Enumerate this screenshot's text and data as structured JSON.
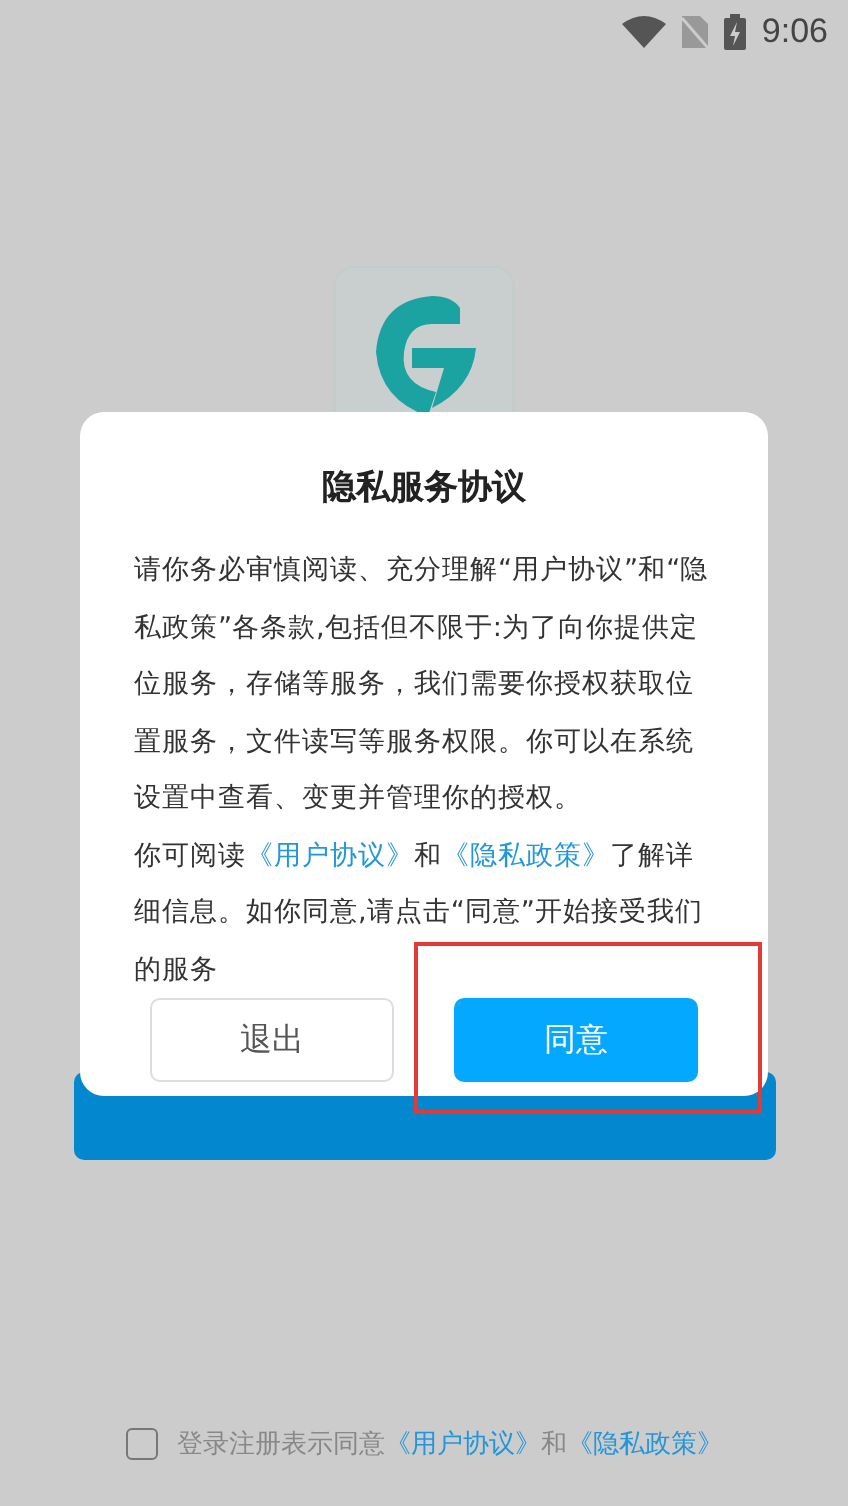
{
  "status_bar": {
    "time": "9:06"
  },
  "agreement": {
    "checked": false,
    "segments": [
      {
        "kind": "text",
        "text": "登录注册表示同意"
      },
      {
        "kind": "link",
        "text": "《用户协议》"
      },
      {
        "kind": "text",
        "text": "和"
      },
      {
        "kind": "link",
        "text": "《隐私政策》"
      }
    ]
  },
  "dialog": {
    "title": "隐私服务协议",
    "paragraphs": [
      [
        {
          "kind": "text",
          "text": "请你务必审慎阅读、充分理解“用户协议”和“隐私政策”各条款,包括但不限于:为了向你提供定位服务，存储等服务，我们需要你授权获取位置服务，文件读写等服务权限。你可以在系统设置中查看、变更并管理你的授权。"
        }
      ],
      [
        {
          "kind": "text",
          "text": "你可阅读"
        },
        {
          "kind": "link",
          "text": "《用户协议》"
        },
        {
          "kind": "text",
          "text": "和"
        },
        {
          "kind": "link",
          "text": "《隐私政策》"
        },
        {
          "kind": "text",
          "text": "了解详细信息。如你同意,请点击“同意”开始接受我们的服务"
        }
      ]
    ],
    "buttons": [
      {
        "label": "退出",
        "kind": "secondary"
      },
      {
        "label": "同意",
        "kind": "primary",
        "highlighted": true
      }
    ]
  }
}
